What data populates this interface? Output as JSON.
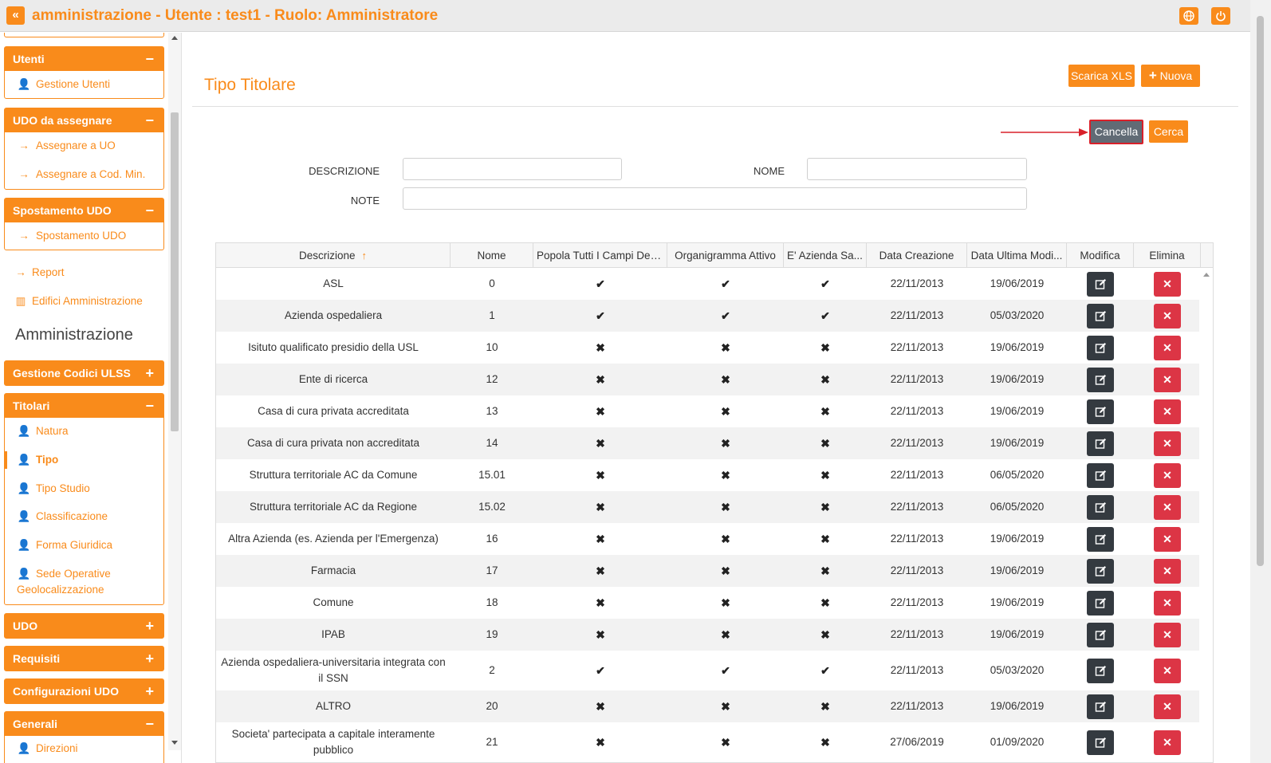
{
  "header": {
    "title": "amministrazione - Utente : test1 - Ruolo: Amministratore",
    "collapse_icon": "double-chevron-left-icon",
    "globe_icon": "globe-icon",
    "power_icon": "power-icon",
    "accent": "#f98b1b"
  },
  "sidebar": {
    "panels": [
      {
        "title": "Utenti",
        "sign": "−",
        "items": [
          "Gestione Utenti"
        ]
      },
      {
        "title": "UDO da assegnare",
        "sign": "−",
        "items": [
          "Assegnare a UO",
          "Assegnare a Cod. Min."
        ]
      },
      {
        "title": "Spostamento UDO",
        "sign": "−",
        "items": [
          "Spostamento UDO"
        ]
      },
      {
        "title": "Gestione Codici ULSS",
        "sign": "+"
      },
      {
        "title": "Titolari",
        "sign": "−",
        "items": [
          "Natura",
          "Tipo",
          "Tipo Studio",
          "Classificazione",
          "Forma Giuridica",
          "Sede Operative Geolocalizzazione"
        ]
      },
      {
        "title": "UDO",
        "sign": "+"
      },
      {
        "title": "Requisiti",
        "sign": "+"
      },
      {
        "title": "Configurazioni UDO",
        "sign": "+"
      },
      {
        "title": "Generali",
        "sign": "−",
        "items": [
          "Direzioni"
        ]
      }
    ],
    "links": [
      "Report",
      "Edifici Amministrazione"
    ],
    "section_heading": "Amministrazione",
    "active_item": "Tipo"
  },
  "main": {
    "page_title": "Tipo Titolare",
    "buttons": {
      "download": "Scarica XLS",
      "new": "Nuova",
      "cancel": "Cancella",
      "search": "Cerca"
    },
    "filters": {
      "descrizione_label": "DESCRIZIONE",
      "descrizione_value": "",
      "nome_label": "NOME",
      "nome_value": "",
      "note_label": "NOTE",
      "note_value": ""
    }
  },
  "table": {
    "columns": [
      "Descrizione",
      "Nome",
      "Popola Tutti I Campi Del ...",
      "Organigramma Attivo",
      "E' Azienda Sa...",
      "Data Creazione",
      "Data Ultima Modi...",
      "Modifica",
      "Elimina"
    ],
    "rows": [
      {
        "descrizione": "ASL",
        "nome": "0",
        "popola": "✔",
        "organigramma": "✔",
        "azienda": "✔",
        "creazione": "22/11/2013",
        "modifica": "19/06/2019"
      },
      {
        "descrizione": "Azienda ospedaliera",
        "nome": "1",
        "popola": "✔",
        "organigramma": "✔",
        "azienda": "✔",
        "creazione": "22/11/2013",
        "modifica": "05/03/2020"
      },
      {
        "descrizione": "Isituto qualificato presidio della USL",
        "nome": "10",
        "popola": "✖",
        "organigramma": "✖",
        "azienda": "✖",
        "creazione": "22/11/2013",
        "modifica": "19/06/2019"
      },
      {
        "descrizione": "Ente di ricerca",
        "nome": "12",
        "popola": "✖",
        "organigramma": "✖",
        "azienda": "✖",
        "creazione": "22/11/2013",
        "modifica": "19/06/2019"
      },
      {
        "descrizione": "Casa di cura privata accreditata",
        "nome": "13",
        "popola": "✖",
        "organigramma": "✖",
        "azienda": "✖",
        "creazione": "22/11/2013",
        "modifica": "19/06/2019"
      },
      {
        "descrizione": "Casa di cura privata non accreditata",
        "nome": "14",
        "popola": "✖",
        "organigramma": "✖",
        "azienda": "✖",
        "creazione": "22/11/2013",
        "modifica": "19/06/2019"
      },
      {
        "descrizione": "Struttura territoriale AC da Comune",
        "nome": "15.01",
        "popola": "✖",
        "organigramma": "✖",
        "azienda": "✖",
        "creazione": "22/11/2013",
        "modifica": "06/05/2020"
      },
      {
        "descrizione": "Struttura territoriale AC da Regione",
        "nome": "15.02",
        "popola": "✖",
        "organigramma": "✖",
        "azienda": "✖",
        "creazione": "22/11/2013",
        "modifica": "06/05/2020"
      },
      {
        "descrizione": "Altra Azienda (es. Azienda per l'Emergenza)",
        "nome": "16",
        "popola": "✖",
        "organigramma": "✖",
        "azienda": "✖",
        "creazione": "22/11/2013",
        "modifica": "19/06/2019"
      },
      {
        "descrizione": "Farmacia",
        "nome": "17",
        "popola": "✖",
        "organigramma": "✖",
        "azienda": "✖",
        "creazione": "22/11/2013",
        "modifica": "19/06/2019"
      },
      {
        "descrizione": "Comune",
        "nome": "18",
        "popola": "✖",
        "organigramma": "✖",
        "azienda": "✖",
        "creazione": "22/11/2013",
        "modifica": "19/06/2019"
      },
      {
        "descrizione": "IPAB",
        "nome": "19",
        "popola": "✖",
        "organigramma": "✖",
        "azienda": "✖",
        "creazione": "22/11/2013",
        "modifica": "19/06/2019"
      },
      {
        "descrizione": "Azienda ospedaliera-universitaria integrata con il SSN",
        "nome": "2",
        "popola": "✔",
        "organigramma": "✔",
        "azienda": "✔",
        "creazione": "22/11/2013",
        "modifica": "05/03/2020"
      },
      {
        "descrizione": "ALTRO",
        "nome": "20",
        "popola": "✖",
        "organigramma": "✖",
        "azienda": "✖",
        "creazione": "22/11/2013",
        "modifica": "19/06/2019"
      },
      {
        "descrizione": "Societa' partecipata a capitale interamente pubblico",
        "nome": "21",
        "popola": "✖",
        "organigramma": "✖",
        "azienda": "✖",
        "creazione": "27/06/2019",
        "modifica": "01/09/2020"
      }
    ]
  }
}
